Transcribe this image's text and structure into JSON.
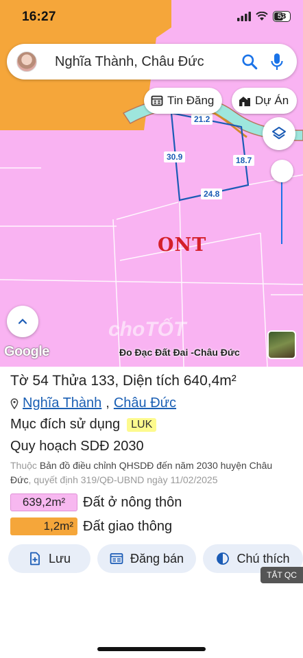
{
  "status_bar": {
    "time": "16:27",
    "battery": "53"
  },
  "search": {
    "query": "Nghĩa Thành, Châu Đức"
  },
  "chips": {
    "listing": "Tin Đăng",
    "project": "Dự Án"
  },
  "map": {
    "edge_labels": [
      "21.2",
      "30.9",
      "18.7",
      "24.8"
    ],
    "zone_label": "ONT",
    "attribution": "Đo Đạc Đất Đai -Châu Đức",
    "google_logo": "Google",
    "watermark": "choTỐT"
  },
  "parcel": {
    "title": "Tờ 54 Thửa 133, Diện tích 640,4m²",
    "ward": "Nghĩa Thành",
    "district": "Châu Đức",
    "purpose_label": "Mục đích sử dụng",
    "purpose_code": "LUK",
    "planning_label": "Quy hoạch SDĐ 2030",
    "source_prefix": "Thuộc",
    "source_main": "Bản đồ điều chỉnh QHSDĐ đến năm 2030 huyện Châu Đức",
    "source_suffix": ", quyết định 319/QĐ-UBND ngày 11/02/2025",
    "zones": [
      {
        "area": "639,2m²",
        "label": "Đất ở nông thôn",
        "color": "#f7b8f0"
      },
      {
        "area": "1,2m²",
        "label": "Đất giao thông",
        "color": "#f5a63a"
      }
    ]
  },
  "actions": {
    "save": "Lưu",
    "post": "Đăng bán",
    "legend": "Chú thích"
  },
  "ad_off": "TẮT QC",
  "colors": {
    "map_pink": "#f9b3f2",
    "map_orange": "#f5a63a",
    "road_teal": "#9ee6dd",
    "accent_blue": "#1a73e8"
  }
}
